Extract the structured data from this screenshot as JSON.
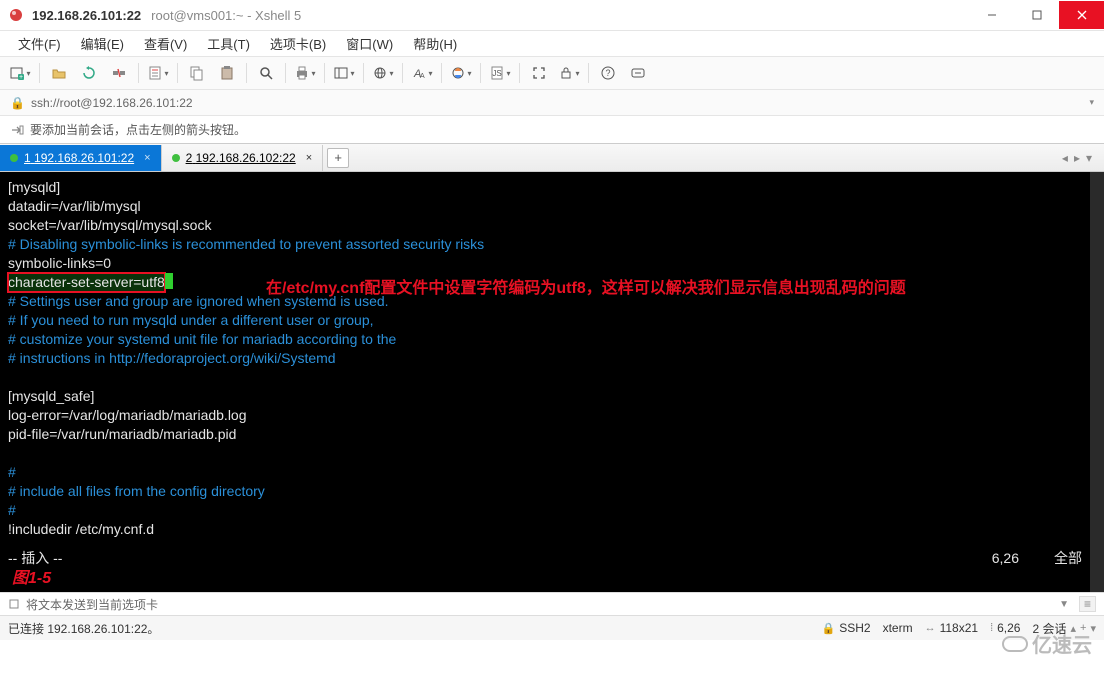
{
  "window": {
    "title_main": "192.168.26.101:22",
    "title_sub": "root@vms001:~ - Xshell 5"
  },
  "menu": {
    "items": [
      "文件(F)",
      "编辑(E)",
      "查看(V)",
      "工具(T)",
      "选项卡(B)",
      "窗口(W)",
      "帮助(H)"
    ]
  },
  "address": {
    "url": "ssh://root@192.168.26.101:22"
  },
  "hint": {
    "text": "要添加当前会话，点击左侧的箭头按钮。"
  },
  "tabs": {
    "items": [
      {
        "num": "1",
        "label": "192.168.26.101:22",
        "active": true
      },
      {
        "num": "2",
        "label": "192.168.26.102:22",
        "active": false
      }
    ]
  },
  "terminal": {
    "lines": [
      {
        "t": "[mysqld]"
      },
      {
        "t": "datadir=/var/lib/mysql"
      },
      {
        "t": "socket=/var/lib/mysql/mysql.sock"
      },
      {
        "t": "# Disabling symbolic-links is recommended to prevent assorted security risks",
        "c": true
      },
      {
        "t": "symbolic-links=0"
      },
      {
        "t": "character-set-server=utf8",
        "hl": true,
        "cursor": true
      },
      {
        "t": "# Settings user and group are ignored when systemd is used.",
        "c": true
      },
      {
        "t": "# If you need to run mysqld under a different user or group,",
        "c": true
      },
      {
        "t": "# customize your systemd unit file for mariadb according to the",
        "c": true
      },
      {
        "t": "# instructions in http://fedoraproject.org/wiki/Systemd",
        "c": true
      },
      {
        "t": ""
      },
      {
        "t": "[mysqld_safe]"
      },
      {
        "t": "log-error=/var/log/mariadb/mariadb.log"
      },
      {
        "t": "pid-file=/var/run/mariadb/mariadb.pid"
      },
      {
        "t": ""
      },
      {
        "t": "#",
        "c": true
      },
      {
        "t": "# include all files from the config directory",
        "c": true
      },
      {
        "t": "#",
        "c": true
      },
      {
        "t": "!includedir /etc/my.cnf.d"
      }
    ],
    "mode": "-- 插入 --",
    "pos": "6,26",
    "scope": "全部",
    "annotation": "在/etc/my.cnf配置文件中设置字符编码为utf8，这样可以解决我们显示信息出现乱码的问题",
    "fig": "图1-5"
  },
  "inputbar": {
    "placeholder": "将文本发送到当前选项卡"
  },
  "status": {
    "conn": "已连接 192.168.26.101:22。",
    "ssh": "SSH2",
    "term": "xterm",
    "size": "118x21",
    "cursor": "6,26",
    "sessions": "2 会话"
  },
  "watermark": "亿速云"
}
